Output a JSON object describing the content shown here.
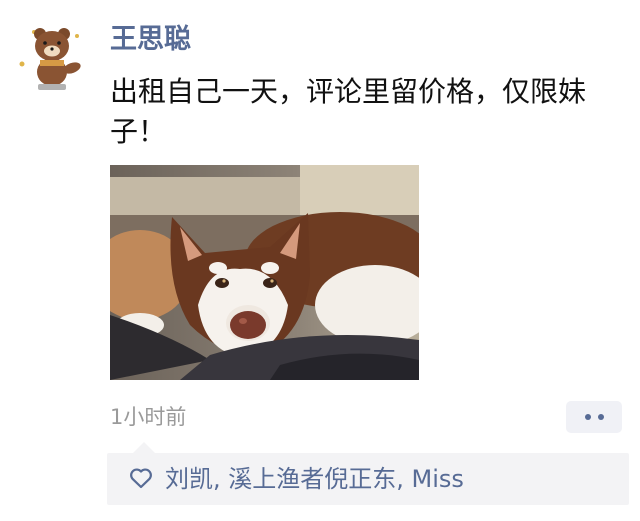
{
  "post": {
    "author": "王思聪",
    "text": "出租自己一天，评论里留价格，仅限妹子！",
    "time": "1小时前",
    "likers": "刘凯, 溪上渔者倪正东, Miss"
  },
  "colors": {
    "name": "#576b95",
    "likes_bg": "#f3f3f5",
    "time": "#9a9a9a"
  },
  "icons": {
    "avatar": "brown-bear-avatar",
    "more": "more-dots-icon",
    "like": "heart-outline-icon"
  }
}
